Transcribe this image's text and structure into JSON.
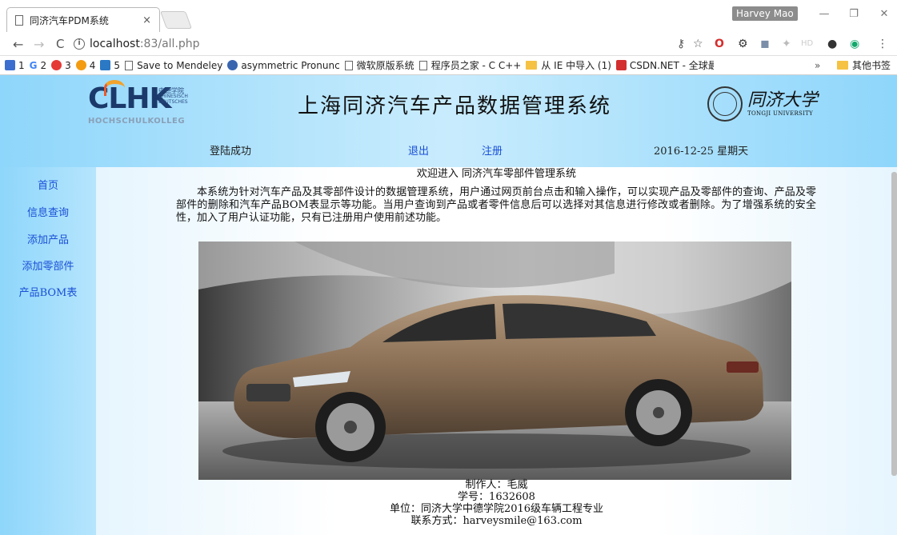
{
  "browser": {
    "tab_title": "同济汽车PDM系统",
    "tab_close": "×",
    "user_name": "Harvey Mao",
    "url_host": "localhost",
    "url_path": ":83/all.php",
    "window_minimize": "—",
    "window_restore": "❐",
    "window_close": "✕",
    "nav_back": "←",
    "nav_forward": "→",
    "nav_reload": "C",
    "bookmarks": [
      {
        "label": "1",
        "color": "#3b6ecf"
      },
      {
        "label": "2",
        "color": "#4285f4",
        "glyph": "G"
      },
      {
        "label": "3",
        "color": "#e53935"
      },
      {
        "label": "4",
        "color": "#f39c12"
      },
      {
        "label": "5",
        "color": "#2b78c5"
      },
      {
        "label": "Save to Mendeley",
        "type": "page"
      },
      {
        "label": "asymmetric Pronunc",
        "color": "#3a66b0"
      },
      {
        "label": "微软原版系统",
        "type": "page"
      },
      {
        "label": "程序员之家 - C C++",
        "type": "page"
      },
      {
        "label": "从 IE 中导入 (1)",
        "type": "folder"
      },
      {
        "label": "CSDN.NET - 全球最大",
        "color": "#d32f2f"
      }
    ],
    "bookmarks_more": "»",
    "bookmarks_other": "其他书签"
  },
  "header": {
    "logo_letters": "CLHK",
    "logo_side_cn": "中德学院",
    "logo_side_1": "CHINESISCH",
    "logo_side_2": "DEUTSCHES",
    "logo_sub": "HOCHSCHULKOLLEG",
    "site_title": "上海同济汽车产品数据管理系统",
    "university_cn": "同济大学",
    "university_en": "TONGJI UNIVERSITY"
  },
  "status": {
    "login_text": "登陆成功",
    "logout_link": "退出",
    "register_link": "注册",
    "date": "2016-12-25 星期天"
  },
  "sidebar": {
    "items": [
      "首页",
      "信息查询",
      "添加产品",
      "添加零部件",
      "产品BOM表"
    ]
  },
  "content": {
    "welcome": "欢迎进入 同济汽车零部件管理系统",
    "intro": "本系统为针对汽车产品及其零部件设计的数据管理系统，用户通过网页前台点击和输入操作，可以实现产品及零部件的查询、产品及零部件的删除和汽车产品BOM表显示等功能。当用户查询到产品或者零件信息后可以选择对其信息进行修改或者删除。为了增强系统的安全性，加入了用户认证功能，只有已注册用户使用前述功能。",
    "footer_author": "制作人：毛威",
    "footer_id": "学号：1632608",
    "footer_unit": "单位：同济大学中德学院2016级车辆工程专业",
    "footer_contact": "联系方式：harveysmile@163.com"
  },
  "colors": {
    "link": "#1a4fd6",
    "header_bg": "#8ed6fb",
    "car_body": "#8a6f55"
  }
}
